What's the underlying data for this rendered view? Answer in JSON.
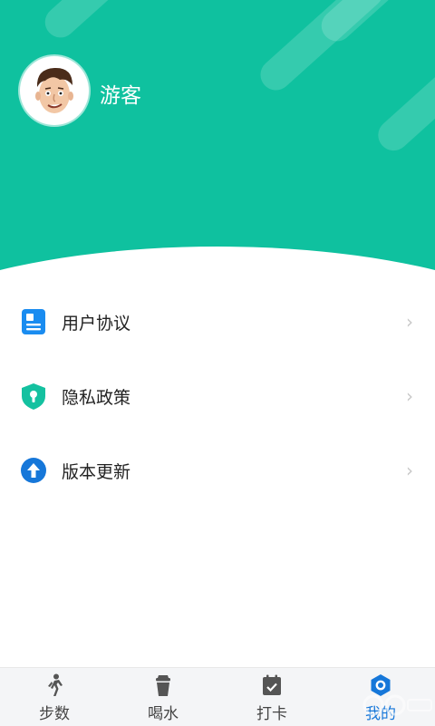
{
  "profile": {
    "name": "游客"
  },
  "menu": [
    {
      "label": "用户协议",
      "icon": "document-icon",
      "color": "#1a8cf0"
    },
    {
      "label": "隐私政策",
      "icon": "shield-lock-icon",
      "color": "#14c1a0"
    },
    {
      "label": "版本更新",
      "icon": "arrow-up-icon",
      "color": "#1677d9"
    }
  ],
  "tabs": [
    {
      "label": "步数",
      "icon": "walking-icon",
      "active": false
    },
    {
      "label": "喝水",
      "icon": "cup-icon",
      "active": false
    },
    {
      "label": "打卡",
      "icon": "calendar-check-icon",
      "active": false
    },
    {
      "label": "我的",
      "icon": "hexagon-settings-icon",
      "active": true
    }
  ],
  "colors": {
    "header": "#0fc19f",
    "active_tab": "#1677d9"
  }
}
